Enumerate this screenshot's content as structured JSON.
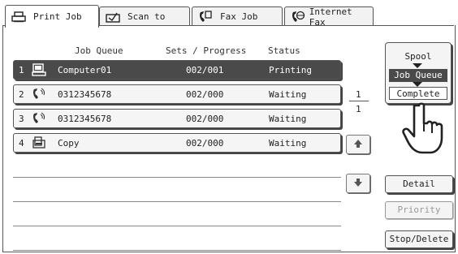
{
  "tabs": [
    {
      "label": "Print Job",
      "icon": "printer-icon",
      "active": true
    },
    {
      "label": "Scan to",
      "icon": "scanner-icon",
      "active": false
    },
    {
      "label": "Fax Job",
      "icon": "fax-icon",
      "active": false
    },
    {
      "label": "Internet Fax",
      "icon": "internet-fax-icon",
      "active": false
    }
  ],
  "columns": {
    "queue": "Job Queue",
    "sets": "Sets / Progress",
    "status": "Status"
  },
  "jobs": [
    {
      "num": "1",
      "icon": "computer-icon",
      "name": "Computer01",
      "sets": "002/001",
      "status": "Printing",
      "selected": true
    },
    {
      "num": "2",
      "icon": "phone-icon",
      "name": "0312345678",
      "sets": "002/000",
      "status": "Waiting",
      "selected": false
    },
    {
      "num": "3",
      "icon": "phone-icon",
      "name": "0312345678",
      "sets": "002/000",
      "status": "Waiting",
      "selected": false
    },
    {
      "num": "4",
      "icon": "copy-icon",
      "name": "Copy",
      "sets": "002/000",
      "status": "Waiting",
      "selected": false
    }
  ],
  "pager": {
    "current": "1",
    "total": "1"
  },
  "modes": {
    "spool": "Spool",
    "job_queue": "Job Queue",
    "complete": "Complete",
    "selected": "Job Queue"
  },
  "buttons": {
    "detail": "Detail",
    "priority": "Priority",
    "stop_delete": "Stop/Delete"
  },
  "colors": {
    "selected_bg": "#4a4a4a",
    "border": "#555555",
    "disabled_text": "#999999"
  }
}
